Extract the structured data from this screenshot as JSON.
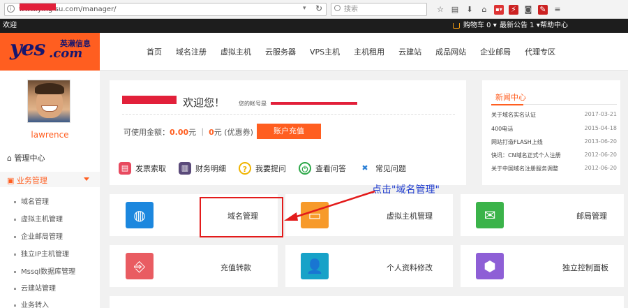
{
  "browser": {
    "url": "www.ying-su.com/manager/",
    "search_placeholder": "搜索",
    "icons": [
      "star-icon",
      "clipboard-icon",
      "download-icon",
      "home-icon",
      "flag-icon",
      "puzzle-icon",
      "pocket-icon",
      "tool-icon",
      "menu-icon"
    ]
  },
  "topbar": {
    "welcome": "欢迎",
    "cart": "购物车 0 ▾",
    "notice": "最新公告 1 ▾",
    "help": "帮助中心"
  },
  "logo": {
    "main": "yes",
    "cn": "英濑信息",
    "com": ".com"
  },
  "nav": [
    "首页",
    "域名注册",
    "虚拟主机",
    "云服务器",
    "VPS主机",
    "主机租用",
    "云建站",
    "成品网站",
    "企业邮局",
    "代理专区"
  ],
  "sidebar": {
    "username": "lawrence",
    "home": "管理中心",
    "active": "业务管理",
    "items": [
      "域名管理",
      "虚拟主机管理",
      "企业邮局管理",
      "独立IP主机管理",
      "Mssql数据库管理",
      "云建站管理",
      "业务转入"
    ]
  },
  "account": {
    "welcome": "欢迎您！",
    "account_label": "您的帐号是",
    "balance_label": "可使用金额：",
    "balance": "0.00",
    "balance_unit": "元",
    "coupon": "0",
    "coupon_unit": "元 (优惠券)",
    "recharge": "账户充值"
  },
  "quick": [
    {
      "label": "发票索取",
      "color": "#e84a5f",
      "icon": "invoice-icon"
    },
    {
      "label": "财务明细",
      "color": "#5a4a7a",
      "icon": "chart-icon"
    },
    {
      "label": "我要提问",
      "color": "#f0b400",
      "icon": "question-icon"
    },
    {
      "label": "查看问答",
      "color": "#2ea84a",
      "icon": "power-icon"
    },
    {
      "label": "常见问题",
      "color": "#2a7fd6",
      "icon": "tools-icon"
    }
  ],
  "news": {
    "title": "新闻中心",
    "items": [
      {
        "t": "关于域名实名认证",
        "d": "2017-03-21"
      },
      {
        "t": "400电话",
        "d": "2015-04-18"
      },
      {
        "t": "网站打造FLASH上线",
        "d": "2013-06-20"
      },
      {
        "t": "快讯：CN域名正式个人注册",
        "d": "2012-06-20"
      },
      {
        "t": "关于中国域名注册服务调整",
        "d": "2012-06-20"
      }
    ]
  },
  "annotation": "点击\"域名管理\"",
  "services": [
    {
      "label": "域名管理",
      "color": "#1c87de",
      "icon": "globe-icon"
    },
    {
      "label": "虚拟主机管理",
      "color": "#f79a2a",
      "icon": "screen-icon"
    },
    {
      "label": "邮局管理",
      "color": "#3bb34a",
      "icon": "mail-icon"
    },
    {
      "label": "充值转款",
      "color": "#e95c62",
      "icon": "plug-icon"
    },
    {
      "label": "个人资料修改",
      "color": "#17a2c8",
      "icon": "user-icon"
    },
    {
      "label": "独立控制面板",
      "color": "#8e5fd6",
      "icon": "cube-icon"
    }
  ],
  "colors": {
    "accent": "#ff5e20",
    "annotation": "#1f3ccf",
    "highlight": "#e31b1b"
  }
}
